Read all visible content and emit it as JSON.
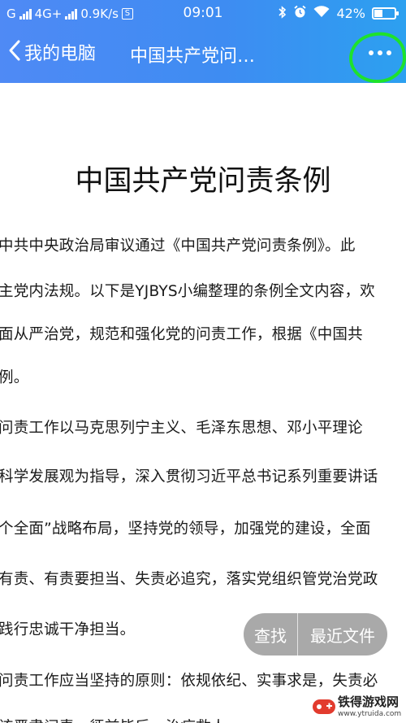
{
  "status_bar": {
    "carrier": "G",
    "network": "4G+",
    "speed": "0.9K/s",
    "sim_icon_text": "S",
    "time": "09:01",
    "battery_percent": "42%",
    "battery_level": 0.42,
    "icons": [
      "signal-icon",
      "bluetooth-icon",
      "alarm-icon",
      "wifi-icon",
      "battery-icon"
    ]
  },
  "nav": {
    "back_label": "我的电脑",
    "title": "中国共产党问…",
    "more_icon": "more-horizontal-icon",
    "highlight_color": "#1ee22c"
  },
  "document": {
    "heading": "中国共产党问责条例",
    "lines": [
      "中共中央政治局审议通过《中国共产党问责条例》。此",
      "主党内法规。以下是YJBYS小编整理的条例全文内容，欢",
      "面从严治党，规范和强化党的问责工作，根据《中国共",
      "例。",
      "问责工作以马克思列宁主义、毛泽东思想、邓小平理论",
      "科学发展观为指导，深入贯彻习近平总书记系列重要讲话",
      "个全面”战略布局，坚持党的领导，加强党的建设，全面",
      "有责、有责要担当、失责必追究，落实党组织管党治党政",
      "践行忠诚干净担当。",
      "问责工作应当坚持的原则：依规依纪、实事求是，失责必",
      "该严肃问责、惩前毖后、治病救人"
    ]
  },
  "floating_actions": {
    "find_label": "查找",
    "recent_label": "最近文件"
  },
  "watermark": {
    "name": "铁得游戏网",
    "url": "www.ytruida.com"
  },
  "colors": {
    "header_start": "#4f8af5",
    "header_end": "#2ca0f0",
    "text": "#1a1a1a"
  }
}
